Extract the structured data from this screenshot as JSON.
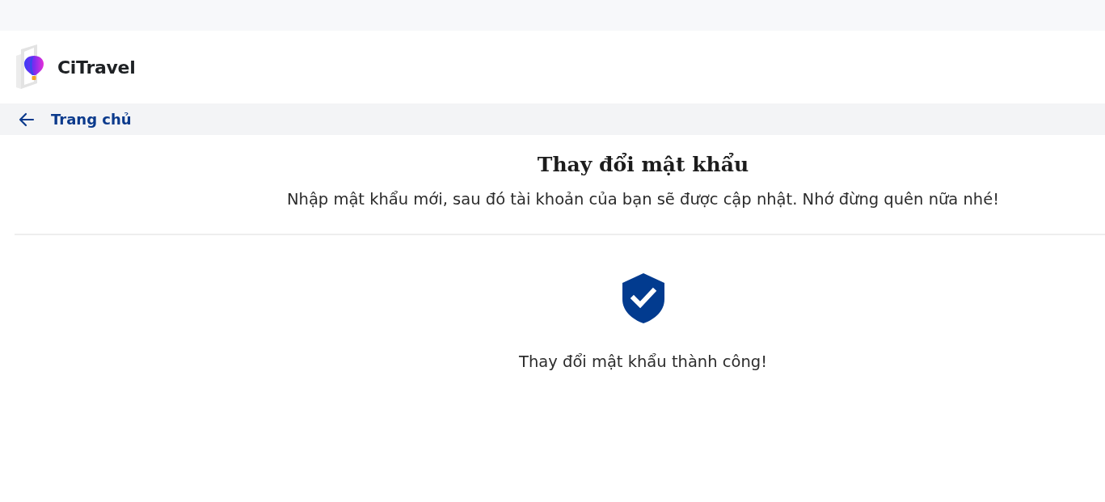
{
  "header": {
    "logo_text": "CiTravel"
  },
  "nav": {
    "back_link": "Trang chủ"
  },
  "page": {
    "title": "Thay đổi mật khẩu",
    "subtitle": "Nhập mật khẩu mới, sau đó tài khoản của bạn sẽ được cập nhật. Nhớ đừng quên nữa nhé!"
  },
  "result": {
    "kind": "success",
    "message": "Thay đổi mật khẩu thành công!"
  }
}
